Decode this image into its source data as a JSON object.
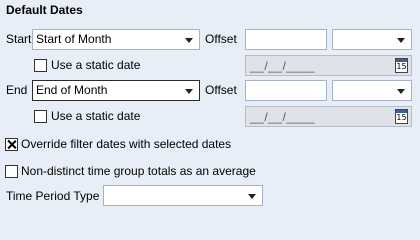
{
  "title": "Default Dates",
  "start": {
    "label": "Start",
    "selected": "Start of Month",
    "offset_label": "Offset",
    "offset_value": "",
    "offset_unit": "",
    "static_label": "Use a static date",
    "static_checked": false,
    "date_placeholder": "__/__/____",
    "calendar_day": "15"
  },
  "end": {
    "label": "End",
    "selected": "End of Month",
    "offset_label": "Offset",
    "offset_value": "",
    "offset_unit": "",
    "static_label": "Use a static date",
    "static_checked": false,
    "date_placeholder": "__/__/____",
    "calendar_day": "15"
  },
  "override": {
    "label": "Override filter dates with selected dates",
    "checked": true
  },
  "nondistinct": {
    "label": "Non-distinct time group totals as an average",
    "checked": false
  },
  "time_period": {
    "label": "Time Period Type",
    "selected": ""
  }
}
